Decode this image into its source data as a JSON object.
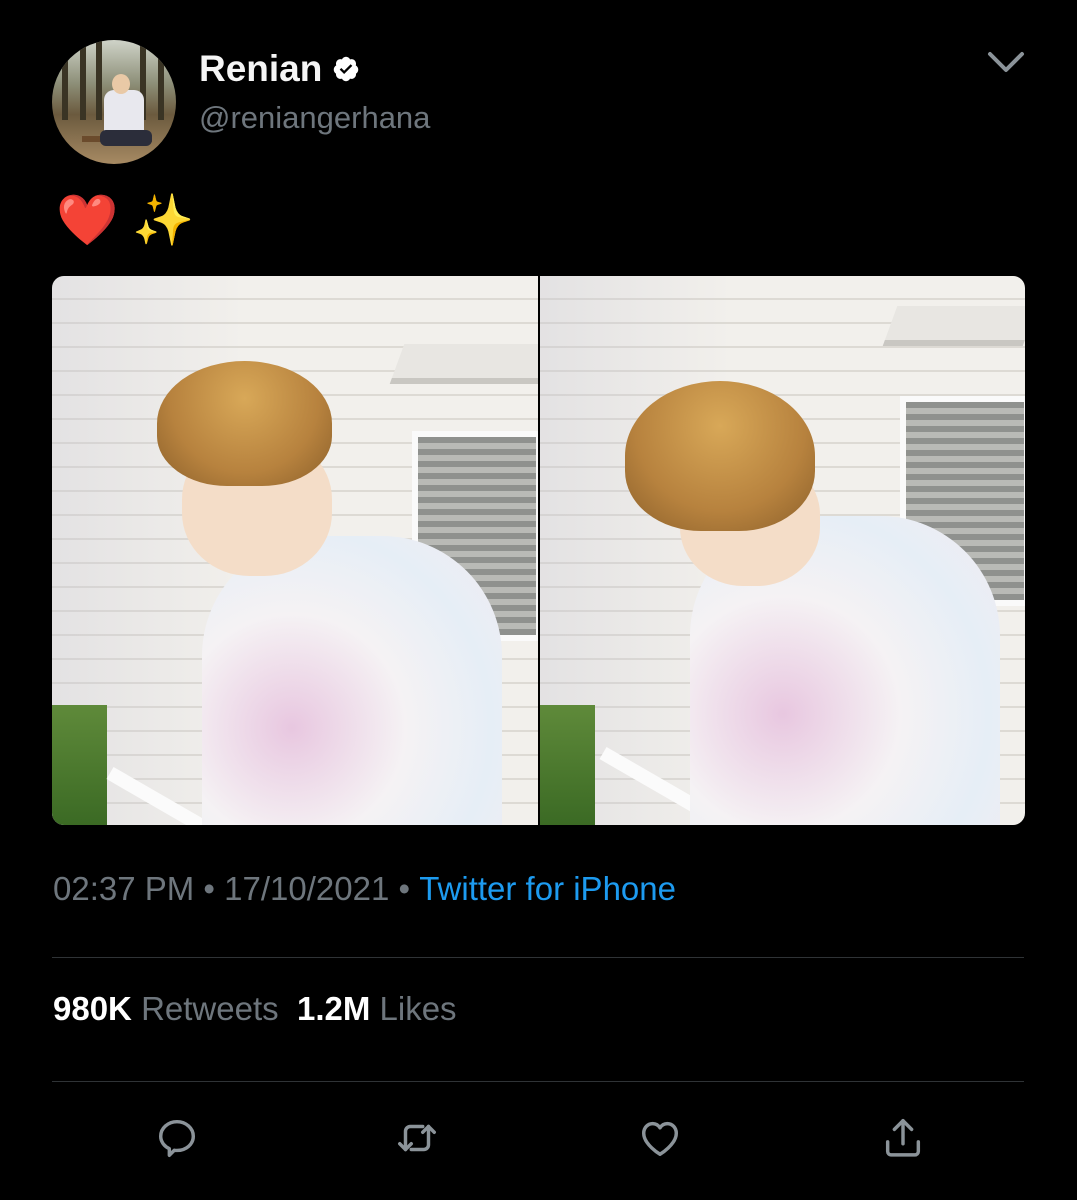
{
  "tweet": {
    "author": {
      "display_name": "Renian",
      "handle": "@reniangerhana",
      "verified": true
    },
    "text_emojis": [
      "❤️",
      "✨"
    ],
    "media_count": 2,
    "time": "02:37 PM",
    "separator": " • ",
    "date": "17/10/2021",
    "source": "Twitter for iPhone",
    "stats": {
      "retweets_value": "980K",
      "retweets_label": "Retweets",
      "likes_value": "1.2M",
      "likes_label": "Likes"
    }
  },
  "icons": {
    "verified": "verified-badge-icon",
    "menu": "chevron-down-icon",
    "reply": "reply-icon",
    "retweet": "retweet-icon",
    "like": "heart-icon",
    "share": "share-icon"
  },
  "colors": {
    "background": "#000000",
    "secondary_text": "#6e767d",
    "link": "#1d9bf0",
    "divider": "#2f3336"
  }
}
